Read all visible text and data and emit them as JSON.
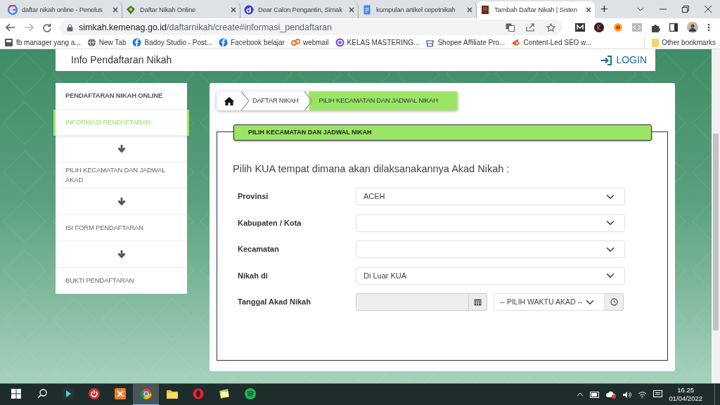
{
  "browser": {
    "tabs": [
      {
        "title": "daftar nikah online - Penelus",
        "selected": false
      },
      {
        "title": "Daftar Nikah Online",
        "selected": false
      },
      {
        "title": "Dear Calon Pengantin, Simak",
        "selected": false
      },
      {
        "title": "kumpulan artikel cepetnikah",
        "selected": false
      },
      {
        "title": "Tambah Daftar Nikah | Sisten",
        "selected": true
      }
    ],
    "new_tab": "+",
    "url": "simkah.kemenag.go.id/daftarnikah/create#informasi_pendaftaran",
    "bookmarks": [
      {
        "label": "fb manager yang a..."
      },
      {
        "label": "New Tab"
      },
      {
        "label": "Badoy Studio - Post..."
      },
      {
        "label": "Facebook belajar"
      },
      {
        "label": "webmail"
      },
      {
        "label": "KELAS MASTERING..."
      },
      {
        "label": "Shopee Affiliate Pro..."
      },
      {
        "label": "Content-Led SEO w..."
      }
    ],
    "other_bookmarks": "Other bookmarks"
  },
  "page": {
    "header_title": "Info Pendaftaran Nikah",
    "login": "LOGIN",
    "sidebar": {
      "items": [
        {
          "kind": "heading",
          "label": "PENDAFTARAN NIKAH ONLINE",
          "selected": false
        },
        {
          "kind": "step",
          "label": "INFORMASI PENDAFTARAN",
          "selected": true
        },
        {
          "kind": "arrow"
        },
        {
          "kind": "step",
          "label": "PILIH KECAMATAN DAN JADWAL AKAD",
          "selected": false
        },
        {
          "kind": "arrow"
        },
        {
          "kind": "step",
          "label": "ISI FORM PENDAFTARAN",
          "selected": false
        },
        {
          "kind": "arrow"
        },
        {
          "kind": "step",
          "label": "BUKTI PENDAFTARAN",
          "selected": false
        }
      ]
    },
    "breadcrumb": [
      {
        "kind": "home",
        "selected": false
      },
      {
        "kind": "crumb",
        "label": "DAFTAR NIKAH",
        "selected": false
      },
      {
        "kind": "crumb",
        "label": "PILIH KECAMATAN DAN JADWAL NIKAH",
        "selected": true
      }
    ],
    "panel_title": "PILIH KECAMATAN DAN JADWAL NIKAH",
    "prompt": "Pilih KUA tempat dimana akan dilaksanakannya Akad Nikah :",
    "fields": [
      {
        "kind": "select",
        "label": "Provinsi",
        "value": "ACEH"
      },
      {
        "kind": "select",
        "label": "Kabupaten / Kota"
      },
      {
        "kind": "select",
        "label": "Kecamatan"
      },
      {
        "kind": "select",
        "label": "Nikah di",
        "value": "Di Luar KUA"
      },
      {
        "kind": "datetime",
        "label": "Tanggal Akad Nikah",
        "time_value": "-- PILIH WAKTU AKAD --"
      }
    ]
  },
  "taskbar": {
    "apps": [
      {
        "kind": "media",
        "selected": false
      },
      {
        "kind": "power",
        "selected": false
      },
      {
        "kind": "xampp",
        "selected": false
      },
      {
        "kind": "browser",
        "selected": true
      },
      {
        "kind": "folder",
        "selected": false
      },
      {
        "kind": "opera",
        "selected": false
      },
      {
        "kind": "notes",
        "selected": false
      },
      {
        "kind": "music",
        "selected": false
      }
    ],
    "time": "16.25",
    "date": "01/04/2022"
  }
}
